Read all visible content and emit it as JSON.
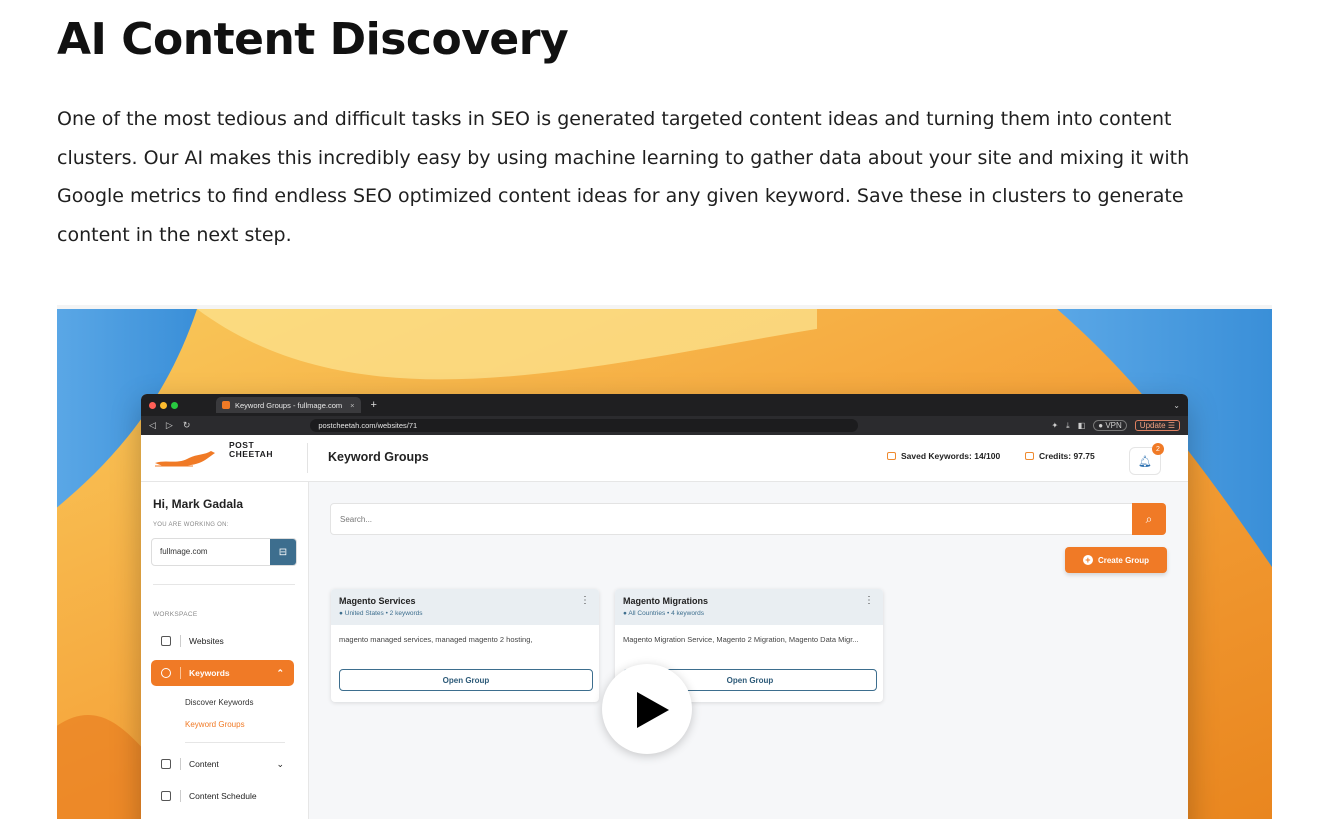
{
  "heading": "AI Content Discovery",
  "intro": "One of the most tedious and difficult tasks in SEO is generated targeted content ideas and turning them into content clusters. Our AI makes this incredibly easy by using machine learning to gather data about your site and mixing it with Google metrics to find endless SEO optimized content ideas for any given keyword. Save these in clusters to generate content in the next step.",
  "browser": {
    "tab_title": "Keyword Groups - fullmage.com",
    "tab_close": "×",
    "new_tab": "+",
    "url": "postcheetah.com/websites/71",
    "vpn": "● VPN",
    "update": "Update ☰"
  },
  "app": {
    "logo_line1": "POST",
    "logo_line2": "CHEETAH",
    "page_title": "Keyword Groups",
    "saved_keywords": "Saved Keywords: 14/100",
    "credits": "Credits: 97.75",
    "notification_count": "2"
  },
  "sidebar": {
    "greeting": "Hi, Mark Gadala",
    "working_on_label": "YOU ARE WORKING ON:",
    "site": "fullmage.com",
    "workspace_label": "WORKSPACE",
    "items": [
      {
        "label": "Websites"
      },
      {
        "label": "Keywords"
      },
      {
        "label": "Content"
      },
      {
        "label": "Content Schedule"
      }
    ],
    "sub_items": [
      {
        "label": "Discover Keywords"
      },
      {
        "label": "Keyword Groups"
      }
    ]
  },
  "main": {
    "search_placeholder": "Search...",
    "create_group": "Create Group",
    "cards": [
      {
        "title": "Magento Services",
        "meta": "United States  •  2 keywords",
        "keywords": "magento managed services, managed magento 2 hosting,",
        "button": "Open Group"
      },
      {
        "title": "Magento Migrations",
        "meta": "All Countries  •  4 keywords",
        "keywords": "Magento Migration Service, Magento 2 Migration, Magento Data Migr...",
        "button": "Open Group"
      }
    ]
  },
  "colors": {
    "accent": "#f07a26",
    "secondary": "#3d6e8e"
  }
}
